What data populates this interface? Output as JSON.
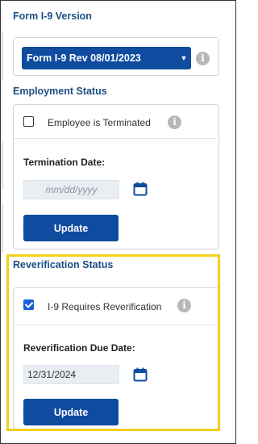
{
  "form_version": {
    "title": "Form I-9 Version",
    "selected": "Form I-9 Rev 08/01/2023"
  },
  "employment_status": {
    "title": "Employment Status",
    "terminated_checkbox": {
      "label": "Employee is Terminated",
      "checked": false
    },
    "termination_date": {
      "label": "Termination Date:",
      "value": "",
      "placeholder": "mm/dd/yyyy"
    },
    "update_label": "Update"
  },
  "reverification_status": {
    "title": "Reverification Status",
    "requires_checkbox": {
      "label": "I-9 Requires Reverification",
      "checked": true
    },
    "due_date": {
      "label": "Reverification Due Date:",
      "value": "12/31/2024"
    },
    "update_label": "Update"
  },
  "icons": {
    "info": "info-icon",
    "calendar": "calendar-icon",
    "dropdown": "chevron-down-icon"
  },
  "colors": {
    "primary": "#0f4c9f",
    "section_title": "#1b4f82",
    "highlight": "#f2cf1d",
    "info_icon": "#b7b7b7"
  }
}
